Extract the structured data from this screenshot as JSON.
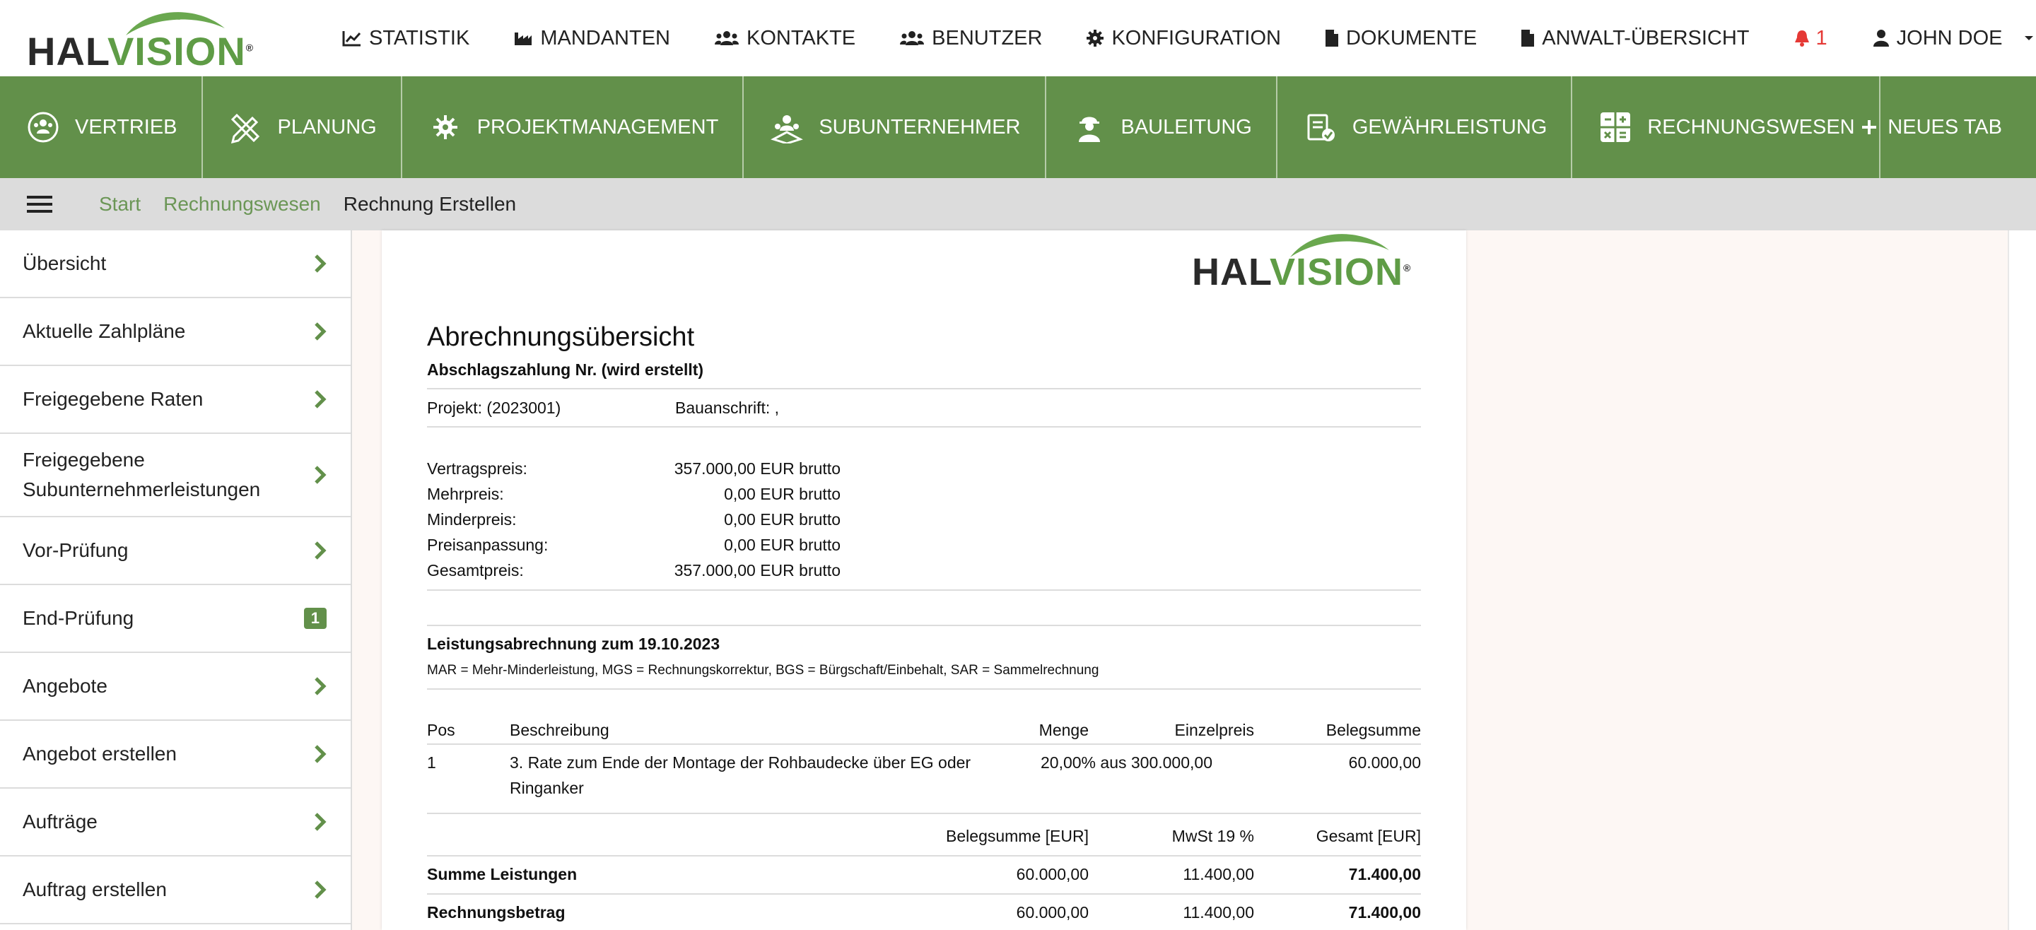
{
  "brand": {
    "logo_dark": "HAL",
    "logo_green": "VISION",
    "logo_reg": "®"
  },
  "topnav": {
    "items": [
      {
        "label": "STATISTIK",
        "icon": "chart-line-icon"
      },
      {
        "label": "MANDANTEN",
        "icon": "industry-icon"
      },
      {
        "label": "KONTAKTE",
        "icon": "users-icon"
      },
      {
        "label": "BENUTZER",
        "icon": "users-icon"
      },
      {
        "label": "KONFIGURATION",
        "icon": "gear-icon"
      },
      {
        "label": "DOKUMENTE",
        "icon": "file-icon"
      },
      {
        "label": "ANWALT-ÜBERSICHT",
        "icon": "file-icon"
      }
    ],
    "notifications": "1",
    "user": "JOHN DOE"
  },
  "modules": {
    "items": [
      {
        "label": "VERTRIEB",
        "icon": "sales-team-icon"
      },
      {
        "label": "PLANUNG",
        "icon": "pencil-ruler-icon"
      },
      {
        "label": "PROJEKTMANAGEMENT",
        "icon": "project-gear-icon"
      },
      {
        "label": "SUBUNTERNEHMER",
        "icon": "subcontractor-icon"
      },
      {
        "label": "BAULEITUNG",
        "icon": "construction-worker-icon"
      },
      {
        "label": "GEWÄHRLEISTUNG",
        "icon": "warranty-clipboard-icon"
      },
      {
        "label": "RECHNUNGSWESEN",
        "icon": "calculator-icon"
      }
    ],
    "new_tab": "NEUES TAB"
  },
  "breadcrumb": {
    "start": "Start",
    "section": "Rechnungswesen",
    "current": "Rechnung Erstellen"
  },
  "sidebar": {
    "items": [
      {
        "label": "Übersicht"
      },
      {
        "label": "Aktuelle Zahlpläne"
      },
      {
        "label": "Freigegebene Raten"
      },
      {
        "label": "Freigegebene Subunternehmerleistungen"
      },
      {
        "label": "Vor-Prüfung"
      },
      {
        "label": "End-Prüfung",
        "badge": "1"
      },
      {
        "label": "Angebote"
      },
      {
        "label": "Angebot erstellen"
      },
      {
        "label": "Aufträge"
      },
      {
        "label": "Auftrag erstellen"
      }
    ]
  },
  "document": {
    "title": "Abrechnungsübersicht",
    "subtitle": "Abschlagszahlung Nr. (wird erstellt)",
    "project": "Projekt: (2023001)",
    "address": "Bauanschrift: ,",
    "prices": [
      {
        "label": "Vertragspreis:",
        "value": "357.000,00 EUR brutto"
      },
      {
        "label": "Mehrpreis:",
        "value": "0,00 EUR brutto"
      },
      {
        "label": "Minderpreis:",
        "value": "0,00 EUR brutto"
      },
      {
        "label": "Preisanpassung:",
        "value": "0,00 EUR brutto"
      },
      {
        "label": "Gesamtpreis:",
        "value": "357.000,00 EUR brutto"
      }
    ],
    "services_title": "Leistungsabrechnung zum 19.10.2023",
    "legend": "MAR = Mehr-Minderleistung, MGS = Rechnungskorrektur, BGS = Bürgschaft/Einbehalt, SAR = Sammelrechnung",
    "table_headers": {
      "pos": "Pos",
      "desc": "Beschreibung",
      "qty": "Menge",
      "unit": "Einzelpreis",
      "total": "Belegsumme"
    },
    "rows": [
      {
        "pos": "1",
        "desc_line1": "3. Rate zum Ende der Montage der Rohbaudecke über EG oder",
        "desc_line2": "Ringanker",
        "qty": "20,00% aus 300.000,00",
        "total": "60.000,00"
      }
    ],
    "sum_headers": {
      "net": "Belegsumme [EUR]",
      "vat": "MwSt 19 %",
      "gross": "Gesamt [EUR]"
    },
    "sums": [
      {
        "label": "Summe Leistungen",
        "net": "60.000,00",
        "vat": "11.400,00",
        "gross": "71.400,00"
      },
      {
        "label": "Rechnungsbetrag",
        "net": "60.000,00",
        "vat": "11.400,00",
        "gross": "71.400,00"
      }
    ]
  },
  "colors": {
    "brand_green": "#62904a",
    "link_green": "#6b9656",
    "alert_red": "#e53935"
  }
}
